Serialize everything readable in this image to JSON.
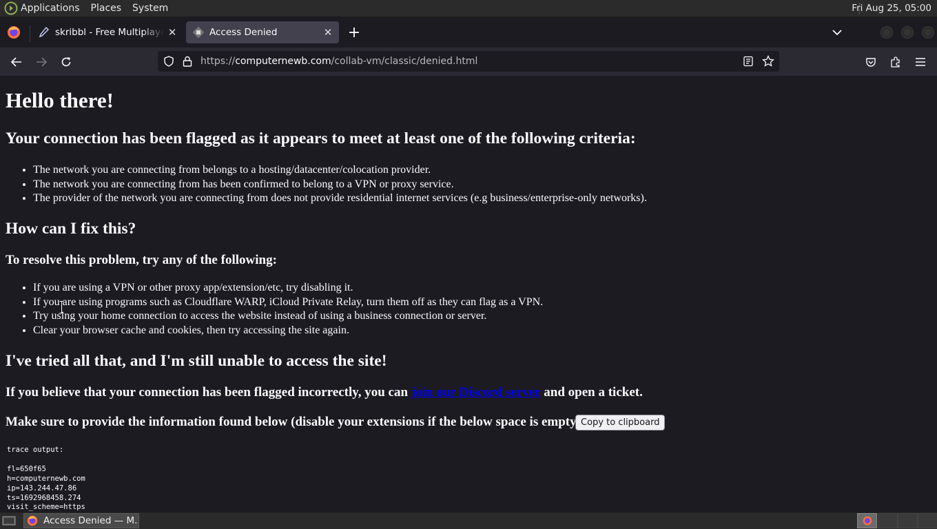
{
  "top_panel": {
    "menus": [
      "Applications",
      "Places",
      "System"
    ],
    "clock": "Fri Aug 25, 05:00"
  },
  "browser": {
    "tabs": [
      {
        "title": "skribbl - Free Multiplayer Drawing & Guessing Game",
        "favicon": "pencil-icon",
        "active": false
      },
      {
        "title": "Access Denied",
        "favicon": "collabvm-icon",
        "active": true
      }
    ],
    "url": {
      "scheme": "https://",
      "host": "computernewb.com",
      "path": "/collab-vm/classic/denied.html"
    }
  },
  "page": {
    "title": "Hello there!",
    "criteria_heading": "Your connection has been flagged as it appears to meet at least one of the following criteria:",
    "criteria": [
      "The network you are connecting from belongs to a hosting/datacenter/colocation provider.",
      "The network you are connecting from has been confirmed to belong to a VPN or proxy service.",
      "The provider of the network you are connecting from does not provide residential internet services (e.g business/enterprise-only networks)."
    ],
    "fix_heading": "How can I fix this?",
    "resolve_heading": "To resolve this problem, try any of the following:",
    "resolve_steps": [
      "If you are using a VPN or other proxy app/extension/etc, try disabling it.",
      "If you are using programs such as Cloudflare WARP, iCloud Private Relay, turn them off as they can flag as a VPN.",
      "Try using your home connection to access the website instead of using a business connection or server.",
      "Clear your browser cache and cookies, then try accessing the site again."
    ],
    "tried_heading": "I've tried all that, and I'm still unable to access the site!",
    "believe_prefix": "If you believe that your connection has been flagged incorrectly, you can",
    "discord_link": "join our Discord server",
    "believe_suffix": "and open a ticket.",
    "provide_text": "Make sure to provide the information found below (disable your extensions if the below space is empty):",
    "copy_button": "Copy to clipboard",
    "trace": [
      "trace output:",
      "",
      "fl=650f65",
      "h=computernewb.com",
      "ip=143.244.47.86",
      "ts=1692968458.274",
      "visit_scheme=https"
    ]
  },
  "taskbar": {
    "window_label": "Access Denied — M..."
  }
}
